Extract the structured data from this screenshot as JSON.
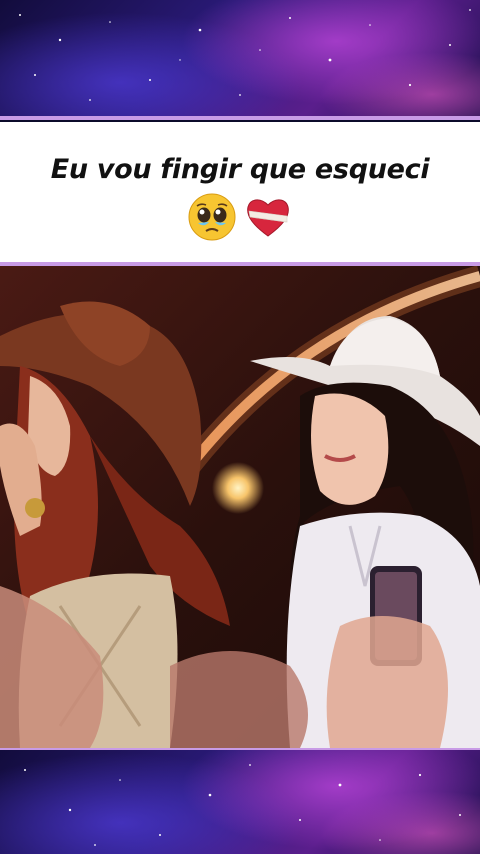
{
  "caption": {
    "text": "Eu vou fingir que esqueci",
    "emojis": [
      "pleading-face-icon",
      "mending-heart-icon"
    ]
  },
  "colors": {
    "divider": "#c89be6",
    "caption_background": "#ffffff",
    "caption_text": "#111111"
  }
}
